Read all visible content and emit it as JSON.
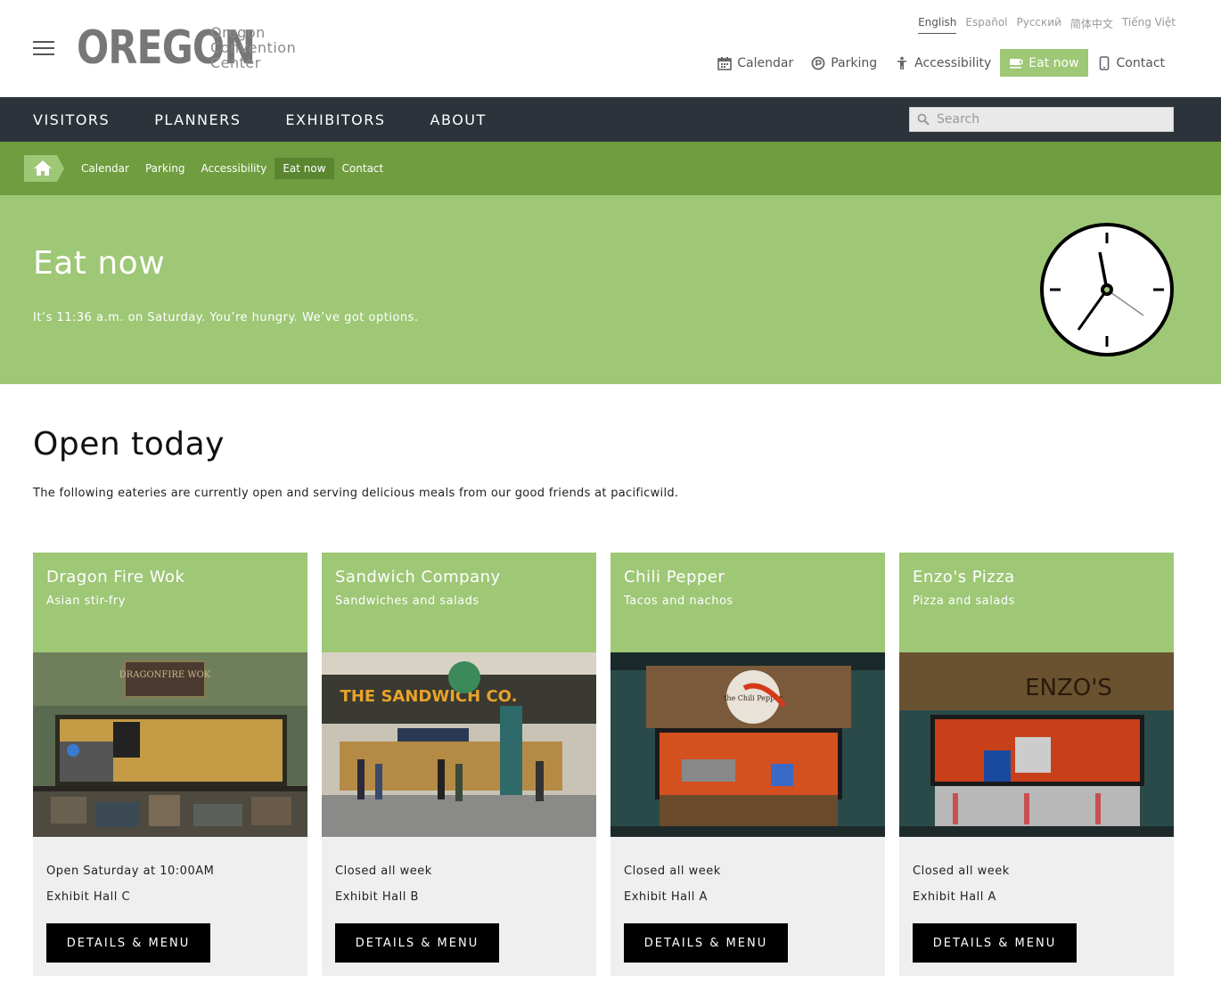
{
  "header": {
    "logo_word": "OREGON",
    "logo_sub": [
      "Oregon",
      "Convention",
      "Center"
    ],
    "languages": [
      {
        "label": "English",
        "active": true
      },
      {
        "label": "Español",
        "active": false
      },
      {
        "label": "Русский",
        "active": false
      },
      {
        "label": "简体中文",
        "active": false
      },
      {
        "label": "Tiếng Việt",
        "active": false
      }
    ],
    "utility": [
      {
        "label": "Calendar",
        "icon": "calendar-icon"
      },
      {
        "label": "Parking",
        "icon": "parking-icon"
      },
      {
        "label": "Accessibility",
        "icon": "accessibility-icon"
      },
      {
        "label": "Eat now",
        "icon": "coffee-cup-icon"
      },
      {
        "label": "Contact",
        "icon": "phone-icon"
      }
    ]
  },
  "mainnav": {
    "items": [
      "VISITORS",
      "PLANNERS",
      "EXHIBITORS",
      "ABOUT"
    ],
    "search_placeholder": "Search"
  },
  "subnav": {
    "items": [
      "Calendar",
      "Parking",
      "Accessibility",
      "Eat now",
      "Contact"
    ]
  },
  "hero": {
    "title": "Eat now",
    "subtitle": "It’s 11:36 a.m. on Saturday. You’re hungry. We’ve got options."
  },
  "content": {
    "title": "Open today",
    "description": "The following eateries are currently open and serving delicious meals from our good friends at pacificwild."
  },
  "cards": [
    {
      "name": "Dragon Fire Wok",
      "type": "Asian stir-fry",
      "sign": "DRAGONFIRE WOK",
      "hours": "Open Saturday at 10:00AM",
      "location": "Exhibit Hall C",
      "button": "DETAILS & MENU"
    },
    {
      "name": "Sandwich Company",
      "type": "Sandwiches and salads",
      "sign": "THE SANDWICH CO.",
      "hours": "Closed all week",
      "location": "Exhibit Hall B",
      "button": "DETAILS & MENU"
    },
    {
      "name": "Chili Pepper",
      "type": "Tacos and nachos",
      "sign": "the Chili Pepper",
      "hours": "Closed all week",
      "location": "Exhibit Hall A",
      "button": "DETAILS & MENU"
    },
    {
      "name": "Enzo's Pizza",
      "type": "Pizza and salads",
      "sign": "ENZO'S",
      "hours": "Closed all week",
      "location": "Exhibit Hall A",
      "button": "DETAILS & MENU"
    }
  ],
  "colors": {
    "accent_green": "#9ec776",
    "dark_green": "#6f9d3f",
    "nav_dark": "#2d333b"
  }
}
